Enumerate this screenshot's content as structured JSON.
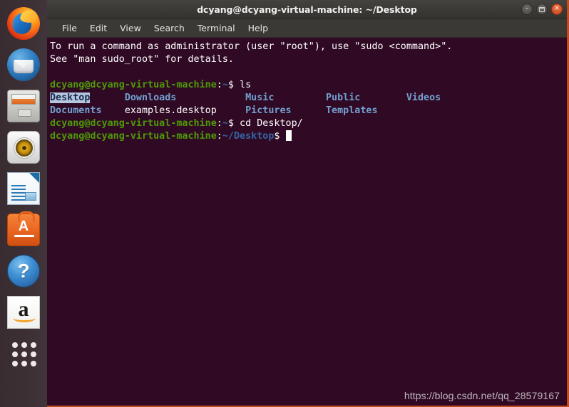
{
  "desktop": {
    "launcher": {
      "name": "unity-launcher",
      "items": [
        {
          "icon": "firefox-icon",
          "label": "Firefox Web Browser"
        },
        {
          "icon": "thunderbird-icon",
          "label": "Thunderbird Mail"
        },
        {
          "icon": "files-icon",
          "label": "Files"
        },
        {
          "icon": "rhythmbox-icon",
          "label": "Rhythmbox"
        },
        {
          "icon": "libreoffice-icon",
          "label": "LibreOffice Writer"
        },
        {
          "icon": "ubuntu-software-icon",
          "label": "Ubuntu Software"
        },
        {
          "icon": "help-icon",
          "label": "Ubuntu Help"
        },
        {
          "icon": "amazon-icon",
          "label": "Amazon"
        },
        {
          "icon": "app-grid-icon",
          "label": "Show Applications"
        }
      ]
    }
  },
  "window": {
    "title": "dcyang@dcyang-virtual-machine: ~/Desktop",
    "controls": {
      "minimize": "–",
      "maximize": "□",
      "close": "✕"
    }
  },
  "menubar": {
    "items": [
      {
        "label": "File"
      },
      {
        "label": "Edit"
      },
      {
        "label": "View"
      },
      {
        "label": "Search"
      },
      {
        "label": "Terminal"
      },
      {
        "label": "Help"
      }
    ]
  },
  "terminal": {
    "colors": {
      "background": "#300a24",
      "foreground": "#ffffff",
      "prompt_user": "#4e9a06",
      "prompt_path": "#3465a4",
      "directory": "#729fcf",
      "selection_bg": "#b5c6e0",
      "selection_fg": "#1a2b4d"
    },
    "lines": [
      {
        "type": "text",
        "text": "To run a command as administrator (user \"root\"), use \"sudo <command>\"."
      },
      {
        "type": "text",
        "text": "See \"man sudo_root\" for details."
      },
      {
        "type": "blank",
        "text": ""
      },
      {
        "type": "prompt",
        "user_host": "dcyang@dcyang-virtual-machine",
        "colon": ":",
        "path": "~",
        "sigil": "$",
        "command": " ls"
      },
      {
        "type": "ls-row",
        "cells": [
          {
            "text": "Desktop",
            "kind": "dir-selected"
          },
          {
            "text": "Downloads",
            "kind": "dir"
          },
          {
            "text": "Music",
            "kind": "dir"
          },
          {
            "text": "Public",
            "kind": "dir"
          },
          {
            "text": "Videos",
            "kind": "dir"
          }
        ]
      },
      {
        "type": "ls-row",
        "cells": [
          {
            "text": "Documents",
            "kind": "dir"
          },
          {
            "text": "examples.desktop",
            "kind": "file"
          },
          {
            "text": "Pictures",
            "kind": "dir"
          },
          {
            "text": "Templates",
            "kind": "dir"
          }
        ]
      },
      {
        "type": "prompt",
        "user_host": "dcyang@dcyang-virtual-machine",
        "colon": ":",
        "path": "~",
        "sigil": "$",
        "command": " cd Desktop/"
      },
      {
        "type": "prompt-cursor",
        "user_host": "dcyang@dcyang-virtual-machine",
        "colon": ":",
        "path": "~/Desktop",
        "sigil": "$",
        "command": " "
      }
    ]
  },
  "watermark": {
    "text": "https://blog.csdn.net/qq_28579167"
  }
}
